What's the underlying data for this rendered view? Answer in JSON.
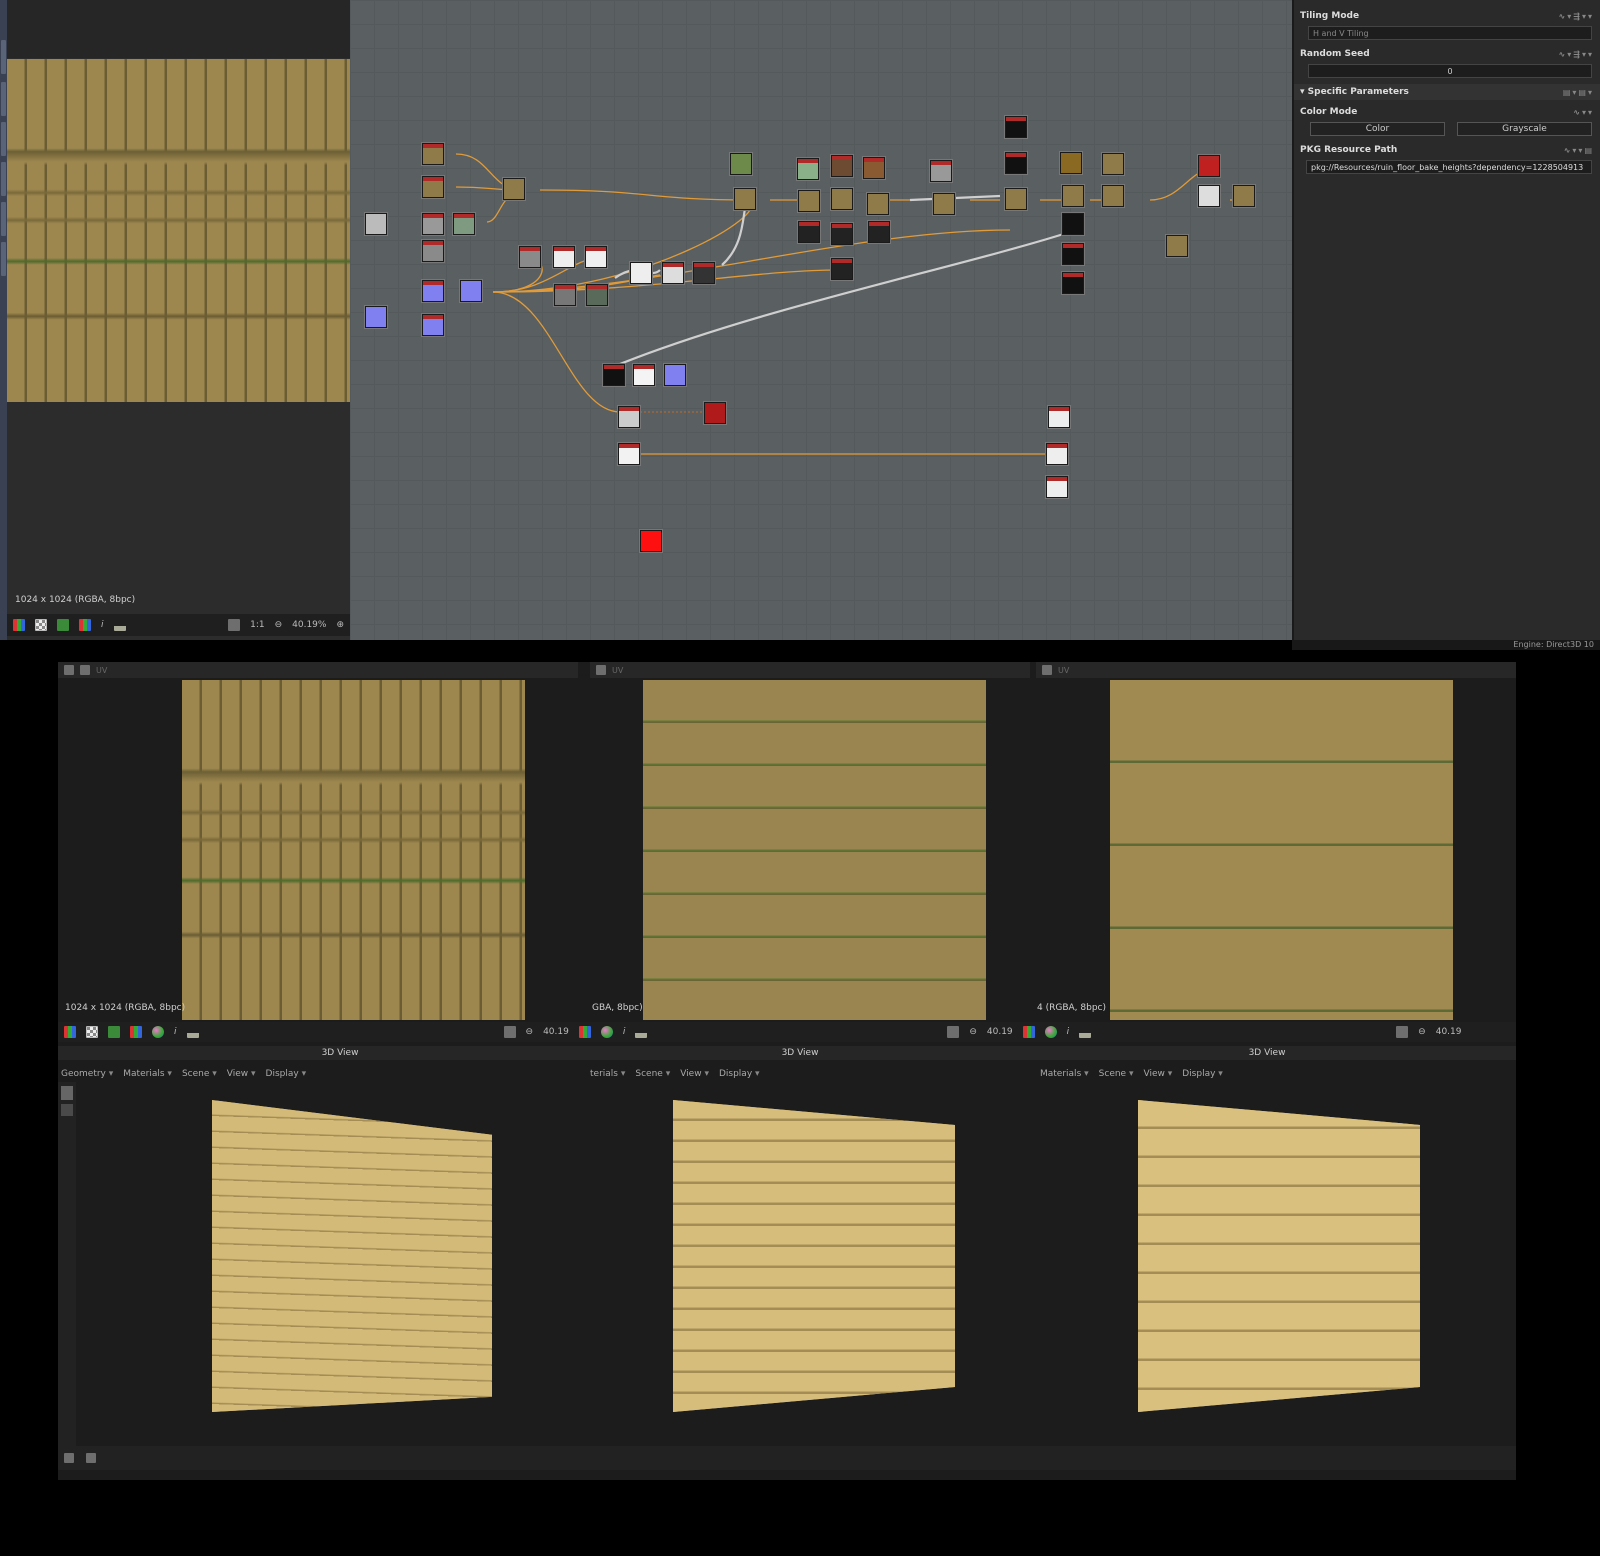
{
  "left_viewer": {
    "resolution": "1024 x 1024 (RGBA, 8bpc)",
    "zoom": "40.19%",
    "one_to_one": "1:1"
  },
  "properties": {
    "tiling_mode": {
      "label": "Tiling Mode",
      "value": "H and V Tiling"
    },
    "random_seed": {
      "label": "Random Seed",
      "value": "0"
    },
    "section": "Specific Parameters",
    "color_mode": {
      "label": "Color Mode",
      "options": [
        "Color",
        "Grayscale"
      ]
    },
    "pkg_path": {
      "label": "PKG Resource Path",
      "value": "pkg://Resources/ruin_floor_bake_heights?dependency=1228504913"
    },
    "engine": "Engine: Direct3D 10"
  },
  "views_2d": [
    {
      "tab": "UV",
      "resolution": "1024 x 1024 (RGBA, 8bpc)",
      "zoom": "40.19"
    },
    {
      "tab": "UV",
      "resolution": "GBA, 8bpc)",
      "zoom": "40.19"
    },
    {
      "tab": "UV",
      "resolution": "4 (RGBA, 8bpc)",
      "zoom": "40.19"
    }
  ],
  "views_3d": [
    {
      "title": "3D View",
      "menus": [
        "Geometry",
        "Materials",
        "Scene",
        "View",
        "Display"
      ]
    },
    {
      "title": "3D View",
      "menus": [
        "terials",
        "Scene",
        "View",
        "Display"
      ]
    },
    {
      "title": "3D View",
      "menus": [
        "Materials",
        "Scene",
        "View",
        "Display"
      ]
    }
  ],
  "colors": {
    "graph_bg": "#5a5f61",
    "accent_wire": "#e09b3a",
    "panel": "#2a2a2a"
  },
  "icons": [
    "rgb-channels-icon",
    "checker-icon",
    "color-icon",
    "sphere-icon",
    "info-icon",
    "histogram-icon",
    "fit-icon",
    "zoom-out-icon"
  ]
}
